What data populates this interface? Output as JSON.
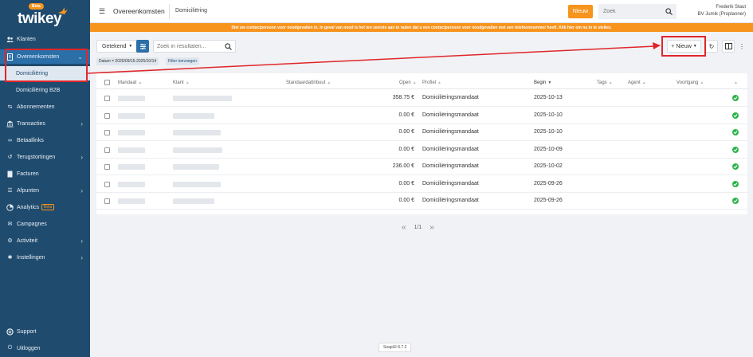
{
  "brand": {
    "beta_label": "Beta",
    "name": "twikey"
  },
  "sidebar": {
    "items": [
      {
        "label": "Klanten",
        "icon": "users-icon"
      },
      {
        "label": "Overeenkomsten",
        "icon": "document-icon"
      },
      {
        "label": "Domiciliëring",
        "icon": ""
      },
      {
        "label": "Domiciliëring B2B",
        "icon": ""
      },
      {
        "label": "Abonnementen",
        "icon": "repeat-icon"
      },
      {
        "label": "Transacties",
        "icon": "bank-icon"
      },
      {
        "label": "Betaallinks",
        "icon": "link-icon"
      },
      {
        "label": "Terugstortingen",
        "icon": "refund-icon"
      },
      {
        "label": "Facturen",
        "icon": "invoice-icon"
      },
      {
        "label": "Afpunten",
        "icon": "list-icon"
      },
      {
        "label": "Analytics",
        "icon": "chart-icon",
        "badge": "Beta"
      },
      {
        "label": "Campagnes",
        "icon": "mail-icon"
      },
      {
        "label": "Activiteit",
        "icon": "activity-icon"
      },
      {
        "label": "Instellingen",
        "icon": "gear-icon"
      },
      {
        "label": "Support",
        "icon": "help-icon"
      },
      {
        "label": "Uitloggen",
        "icon": "power-icon"
      }
    ]
  },
  "topbar": {
    "title": "Overeenkomsten",
    "subtitle": "Domiciliëring",
    "new_label": "Nieuw",
    "search_placeholder": "Zoek",
    "user_name": "Frederik Staut",
    "user_company": "BV Jumik (Proplanner)"
  },
  "banner": "Stel uw contactpersoon voor noodgevallen in. In geval van nood is het ten zeerste aan te raden dat u een contactpersoon voor noodgevallen met een telefoonnummer heeft. Klik hier om nu in te stellen.",
  "toolbar": {
    "filter_label": "Getekend",
    "search_placeholder": "Zoek in resultaten...",
    "chip_date": "Datum = 2025/09/15-2025/10/14",
    "chip_filter": "Filter toevoegen",
    "new_label": "+ Nieuw"
  },
  "table": {
    "headers": {
      "mandaat": "Mandaat",
      "klant": "Klant",
      "standaard": "Standaardattribuut",
      "open": "Open",
      "profiel": "Profiel",
      "begin": "Begin",
      "tags": "Tags",
      "agent": "Agent",
      "voortgang": "Voortgang"
    },
    "rows": [
      {
        "open": "358.75 €",
        "profiel": "Domiciliëringsmandaat",
        "begin": "2025-10-13"
      },
      {
        "open": "0.00 €",
        "profiel": "Domiciliëringsmandaat",
        "begin": "2025-10-10"
      },
      {
        "open": "0.00 €",
        "profiel": "Domiciliëringsmandaat",
        "begin": "2025-10-10"
      },
      {
        "open": "0.00 €",
        "profiel": "Domiciliëringsmandaat",
        "begin": "2025-10-09"
      },
      {
        "open": "236.00 €",
        "profiel": "Domiciliëringsmandaat",
        "begin": "2025-10-02"
      },
      {
        "open": "0.00 €",
        "profiel": "Domiciliëringsmandaat",
        "begin": "2025-09-26"
      },
      {
        "open": "0.00 €",
        "profiel": "Domiciliëringsmandaat",
        "begin": "2025-09-26"
      }
    ]
  },
  "pager": {
    "page": "1/1"
  },
  "footer": {
    "version": "SoapUI-5.7.2"
  },
  "colors": {
    "accent": "#f7941d",
    "sidebar": "#1f4b6e",
    "annotation": "#e0262a",
    "success": "#2eb34a"
  }
}
